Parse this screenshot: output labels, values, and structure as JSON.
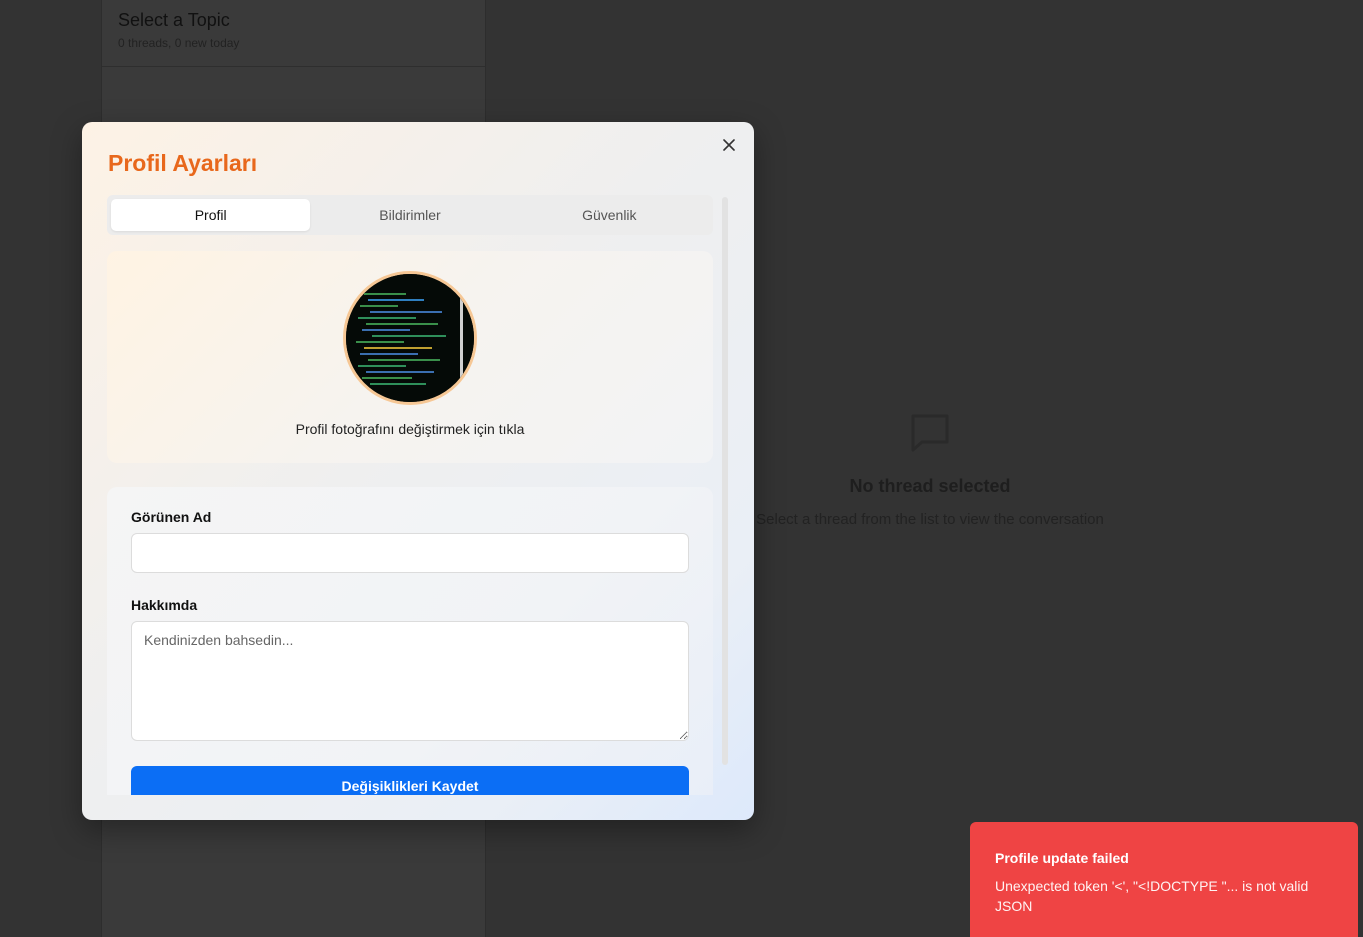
{
  "sidebar": {
    "topic_title": "Select a Topic",
    "topic_stats": "0 threads, 0 new today"
  },
  "thread_view": {
    "empty_icon": "chat-bubble-icon",
    "empty_title": "No thread selected",
    "empty_subtitle": "Select a thread from the list to view the conversation"
  },
  "modal": {
    "title": "Profil Ayarları",
    "close_icon": "close-icon",
    "tabs": [
      {
        "label": "Profil",
        "active": true
      },
      {
        "label": "Bildirimler",
        "active": false
      },
      {
        "label": "Güvenlik",
        "active": false
      }
    ],
    "avatar": {
      "caption": "Profil fotoğrafını değiştirmek için tıkla"
    },
    "form": {
      "display_name_label": "Görünen Ad",
      "display_name_value": "",
      "about_label": "Hakkımda",
      "about_placeholder": "Kendinizden bahsedin...",
      "save_label": "Değişiklikleri Kaydet"
    }
  },
  "toast": {
    "title": "Profile update failed",
    "message": "Unexpected token '<', \"<!DOCTYPE \"... is not valid JSON"
  },
  "colors": {
    "accent": "#e8681c",
    "primary_button": "#0b6ef5",
    "error": "#ef4444"
  }
}
